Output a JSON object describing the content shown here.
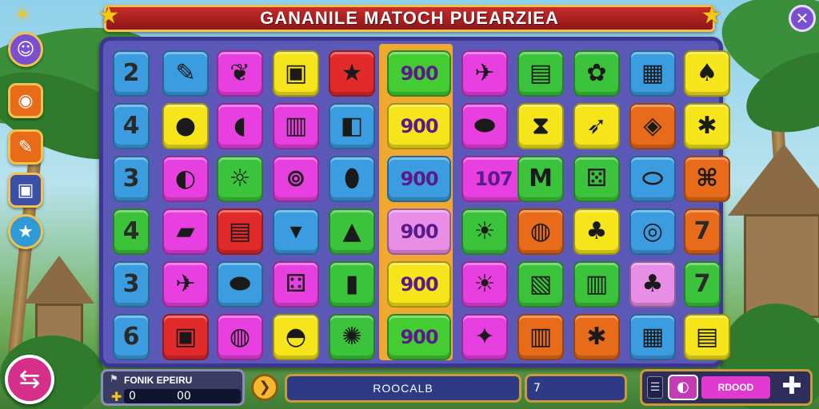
{
  "header": {
    "title": "GANANILE MATOCH PUEARZIEA",
    "corner_icon": "sun-mascot-icon",
    "left_star": "star-icon",
    "right_star": "star-icon",
    "close_glyph": "✕"
  },
  "sidebar": {
    "items": [
      {
        "name": "profile-icon",
        "glyph": "☺",
        "color": "#7a4fd0"
      },
      {
        "name": "gem-icon",
        "glyph": "◉",
        "color": "#e86b1a"
      },
      {
        "name": "boot-icon",
        "glyph": "✎",
        "color": "#e86b1a"
      },
      {
        "name": "gift-box-icon",
        "glyph": "▣",
        "color": "#3a4fa8"
      },
      {
        "name": "star-icon",
        "glyph": "★",
        "color": "#2f9bd6"
      }
    ]
  },
  "board": {
    "highlight_column": 5,
    "rows": [
      [
        {
          "t": "2",
          "c": "#3b9de0"
        },
        {
          "t": "✎",
          "c": "#3b9de0",
          "i": "brush-icon"
        },
        {
          "t": "❦",
          "c": "#e83fe0",
          "i": "leaf-icon"
        },
        {
          "t": "▣",
          "c": "#f5e51a",
          "i": "gift-box-icon"
        },
        {
          "t": "★",
          "c": "#e22a2a",
          "i": "star-icon"
        },
        {
          "t": "900",
          "c": "#44cc33",
          "s": true
        },
        {
          "t": "✈",
          "c": "#e83fe0",
          "i": "jet-icon"
        },
        {
          "t": "▤",
          "c": "#3bc43b",
          "i": "crate-icon"
        },
        {
          "t": "✿",
          "c": "#3bc43b",
          "i": "flower-icon"
        },
        {
          "t": "▦",
          "c": "#3b9de0",
          "i": "box-icon"
        },
        {
          "t": "♠",
          "c": "#f5e51a",
          "i": "drop-icon"
        }
      ],
      [
        {
          "t": "4",
          "c": "#3b9de0"
        },
        {
          "t": "●",
          "c": "#f5e51a",
          "i": "tomato-icon"
        },
        {
          "t": "◖",
          "c": "#e83fe0",
          "i": "bread-icon"
        },
        {
          "t": "▥",
          "c": "#e83fe0",
          "i": "cage-icon"
        },
        {
          "t": "◧",
          "c": "#3b9de0",
          "i": "cube-icon"
        },
        {
          "t": "900",
          "c": "#f5e51a",
          "s": true
        },
        {
          "t": "⬬",
          "c": "#e83fe0",
          "i": "cucumber-icon"
        },
        {
          "t": "⧗",
          "c": "#f5e51a",
          "i": "hourglass-icon"
        },
        {
          "t": "➶",
          "c": "#f5e51a",
          "i": "arrow-icon"
        },
        {
          "t": "◈",
          "c": "#e86b1a",
          "i": "jar-icon"
        },
        {
          "t": "✱",
          "c": "#f5e51a",
          "i": "starfish-icon"
        }
      ],
      [
        {
          "t": "3",
          "c": "#3b9de0"
        },
        {
          "t": "◐",
          "c": "#e83fe0",
          "i": "lemon-icon"
        },
        {
          "t": "☼",
          "c": "#3bc43b",
          "i": "sun-icon"
        },
        {
          "t": "⊚",
          "c": "#e83fe0",
          "i": "rings-icon"
        },
        {
          "t": "⬮",
          "c": "#3b9de0",
          "i": "pickle-icon"
        },
        {
          "t": "900",
          "c": "#3b9de0",
          "s": true
        },
        {
          "t": "107",
          "c": "#e83fe0",
          "s": true
        },
        {
          "t": "M",
          "c": "#3bc43b",
          "i": "letter-m-icon"
        },
        {
          "t": "⚄",
          "c": "#3bc43b",
          "i": "dice-icon"
        },
        {
          "t": "⬭",
          "c": "#3b9de0",
          "i": "egg-icon"
        },
        {
          "t": "⌘",
          "c": "#e86b1a",
          "i": "scroll-icon"
        }
      ],
      [
        {
          "t": "4",
          "c": "#3bc43b"
        },
        {
          "t": "▰",
          "c": "#e83fe0",
          "i": "battery-icon"
        },
        {
          "t": "▤",
          "c": "#e22a2a",
          "i": "radio-icon"
        },
        {
          "t": "▾",
          "c": "#3b9de0",
          "i": "cup-icon"
        },
        {
          "t": "▲",
          "c": "#3bc43b",
          "i": "corn-icon"
        },
        {
          "t": "900",
          "c": "#e98ee6",
          "s": true
        },
        {
          "t": "☀",
          "c": "#3bc43b",
          "i": "sunflower-icon"
        },
        {
          "t": "◍",
          "c": "#e86b1a",
          "i": "snail-icon"
        },
        {
          "t": "♣",
          "c": "#f5e51a",
          "i": "berry-icon"
        },
        {
          "t": "◎",
          "c": "#3b9de0",
          "i": "ring-icon"
        },
        {
          "t": "7",
          "c": "#e86b1a"
        }
      ],
      [
        {
          "t": "3",
          "c": "#3b9de0"
        },
        {
          "t": "✈",
          "c": "#e83fe0",
          "i": "jet-icon"
        },
        {
          "t": "⬬",
          "c": "#3b9de0",
          "i": "melon-icon"
        },
        {
          "t": "⚃",
          "c": "#e83fe0",
          "i": "dice-icon"
        },
        {
          "t": "▮",
          "c": "#3bc43b",
          "i": "jar-icon"
        },
        {
          "t": "900",
          "c": "#f5e51a",
          "s": true
        },
        {
          "t": "☀",
          "c": "#e83fe0",
          "i": "sun-face-icon"
        },
        {
          "t": "▧",
          "c": "#3bc43b",
          "i": "tile-icon"
        },
        {
          "t": "▥",
          "c": "#3bc43b",
          "i": "cage-icon"
        },
        {
          "t": "♣",
          "c": "#e98ee6",
          "i": "bunny-icon"
        },
        {
          "t": "7",
          "c": "#3bc43b"
        }
      ],
      [
        {
          "t": "6",
          "c": "#3b9de0"
        },
        {
          "t": "▣",
          "c": "#e22a2a",
          "i": "gift-box-icon"
        },
        {
          "t": "◍",
          "c": "#e83fe0",
          "i": "pepper-icon"
        },
        {
          "t": "◓",
          "c": "#f5e51a",
          "i": "bowl-icon"
        },
        {
          "t": "✺",
          "c": "#3bc43b",
          "i": "burst-icon"
        },
        {
          "t": "900",
          "c": "#44cc33",
          "s": true
        },
        {
          "t": "✦",
          "c": "#e83fe0",
          "i": "sparkle-icon"
        },
        {
          "t": "▥",
          "c": "#e86b1a",
          "i": "crayons-icon"
        },
        {
          "t": "✱",
          "c": "#e86b1a",
          "i": "starfish-icon"
        },
        {
          "t": "▦",
          "c": "#3b9de0",
          "i": "box-icon"
        },
        {
          "t": "▤",
          "c": "#f5e51a",
          "i": "crate-icon"
        }
      ]
    ]
  },
  "player": {
    "icon": "flag-icon",
    "name": "FONIK EPEIRU",
    "coins_icon": "coin-icon",
    "value_1": "0",
    "value_2": "00"
  },
  "bottom_bar": {
    "arrow_glyph": "❯",
    "main_label": "ROOCALB",
    "count_label": "7"
  },
  "actions": {
    "menu_glyph": "☰",
    "circle_glyph": "◐",
    "label": "RDOOD",
    "plus_glyph": "✚"
  },
  "swap_button": {
    "glyph": "⇆"
  }
}
